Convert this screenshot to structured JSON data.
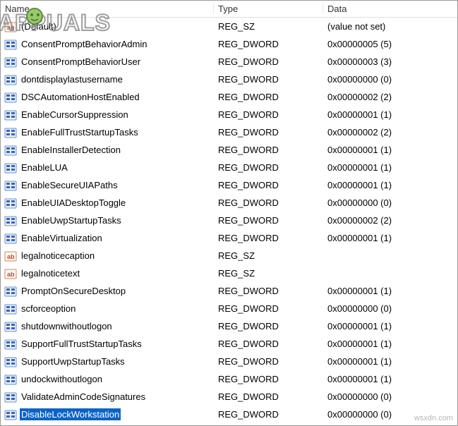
{
  "columns": {
    "name": "Name",
    "type": "Type",
    "data": "Data"
  },
  "watermark": "wsxdn.com",
  "logo_text": "APPUALS",
  "entries": [
    {
      "icon": "sz",
      "name": "(Default)",
      "type": "REG_SZ",
      "data": "(value not set)",
      "selected": false
    },
    {
      "icon": "dword",
      "name": "ConsentPromptBehaviorAdmin",
      "type": "REG_DWORD",
      "data": "0x00000005 (5)",
      "selected": false
    },
    {
      "icon": "dword",
      "name": "ConsentPromptBehaviorUser",
      "type": "REG_DWORD",
      "data": "0x00000003 (3)",
      "selected": false
    },
    {
      "icon": "dword",
      "name": "dontdisplaylastusername",
      "type": "REG_DWORD",
      "data": "0x00000000 (0)",
      "selected": false
    },
    {
      "icon": "dword",
      "name": "DSCAutomationHostEnabled",
      "type": "REG_DWORD",
      "data": "0x00000002 (2)",
      "selected": false
    },
    {
      "icon": "dword",
      "name": "EnableCursorSuppression",
      "type": "REG_DWORD",
      "data": "0x00000001 (1)",
      "selected": false
    },
    {
      "icon": "dword",
      "name": "EnableFullTrustStartupTasks",
      "type": "REG_DWORD",
      "data": "0x00000002 (2)",
      "selected": false
    },
    {
      "icon": "dword",
      "name": "EnableInstallerDetection",
      "type": "REG_DWORD",
      "data": "0x00000001 (1)",
      "selected": false
    },
    {
      "icon": "dword",
      "name": "EnableLUA",
      "type": "REG_DWORD",
      "data": "0x00000001 (1)",
      "selected": false
    },
    {
      "icon": "dword",
      "name": "EnableSecureUIAPaths",
      "type": "REG_DWORD",
      "data": "0x00000001 (1)",
      "selected": false
    },
    {
      "icon": "dword",
      "name": "EnableUIADesktopToggle",
      "type": "REG_DWORD",
      "data": "0x00000000 (0)",
      "selected": false
    },
    {
      "icon": "dword",
      "name": "EnableUwpStartupTasks",
      "type": "REG_DWORD",
      "data": "0x00000002 (2)",
      "selected": false
    },
    {
      "icon": "dword",
      "name": "EnableVirtualization",
      "type": "REG_DWORD",
      "data": "0x00000001 (1)",
      "selected": false
    },
    {
      "icon": "sz",
      "name": "legalnoticecaption",
      "type": "REG_SZ",
      "data": "",
      "selected": false
    },
    {
      "icon": "sz",
      "name": "legalnoticetext",
      "type": "REG_SZ",
      "data": "",
      "selected": false
    },
    {
      "icon": "dword",
      "name": "PromptOnSecureDesktop",
      "type": "REG_DWORD",
      "data": "0x00000001 (1)",
      "selected": false
    },
    {
      "icon": "dword",
      "name": "scforceoption",
      "type": "REG_DWORD",
      "data": "0x00000000 (0)",
      "selected": false
    },
    {
      "icon": "dword",
      "name": "shutdownwithoutlogon",
      "type": "REG_DWORD",
      "data": "0x00000001 (1)",
      "selected": false
    },
    {
      "icon": "dword",
      "name": "SupportFullTrustStartupTasks",
      "type": "REG_DWORD",
      "data": "0x00000001 (1)",
      "selected": false
    },
    {
      "icon": "dword",
      "name": "SupportUwpStartupTasks",
      "type": "REG_DWORD",
      "data": "0x00000001 (1)",
      "selected": false
    },
    {
      "icon": "dword",
      "name": "undockwithoutlogon",
      "type": "REG_DWORD",
      "data": "0x00000001 (1)",
      "selected": false
    },
    {
      "icon": "dword",
      "name": "ValidateAdminCodeSignatures",
      "type": "REG_DWORD",
      "data": "0x00000000 (0)",
      "selected": false
    },
    {
      "icon": "dword",
      "name": "DisableLockWorkstation",
      "type": "REG_DWORD",
      "data": "0x00000000 (0)",
      "selected": true
    }
  ]
}
